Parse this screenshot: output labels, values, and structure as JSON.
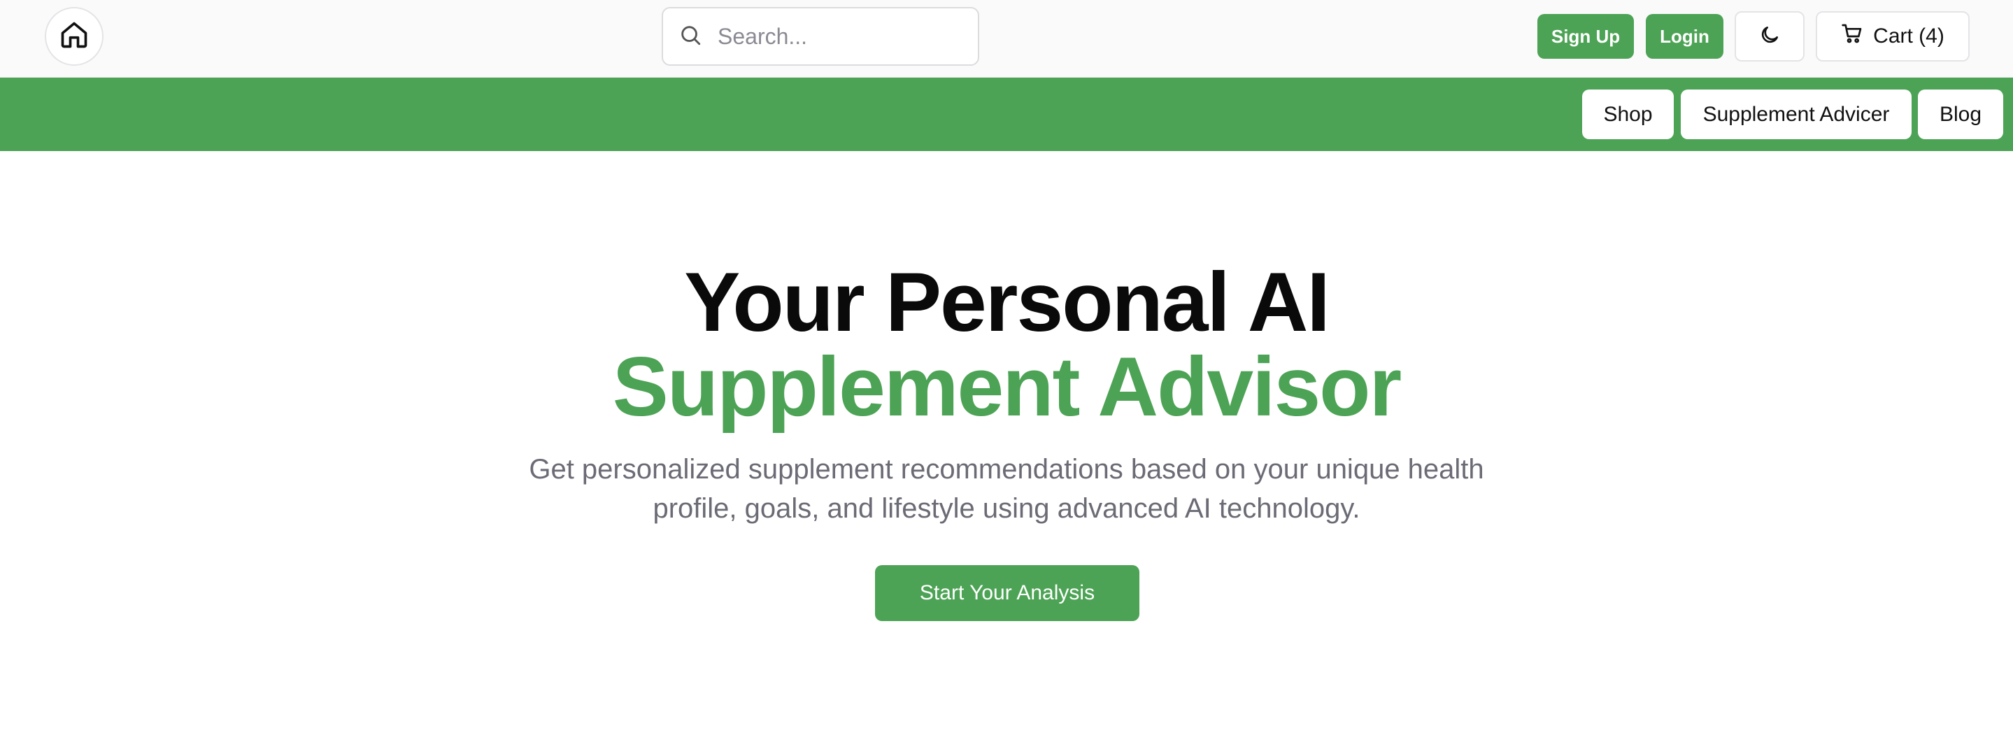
{
  "header": {
    "home_icon": "house-icon",
    "search": {
      "placeholder": "Search...",
      "value": "",
      "icon": "search-icon"
    },
    "signup_label": "Sign Up",
    "login_label": "Login",
    "theme_icon": "moon-icon",
    "cart": {
      "label": "Cart (4)",
      "icon": "cart-icon"
    }
  },
  "nav": {
    "items": [
      {
        "label": "Shop"
      },
      {
        "label": "Supplement Advicer"
      },
      {
        "label": "Blog"
      }
    ]
  },
  "hero": {
    "title_line1": "Your Personal AI",
    "title_line2": "Supplement Advisor",
    "subtitle": "Get personalized supplement recommendations based on your unique health profile, goals, and lifestyle using advanced AI technology.",
    "cta_label": "Start Your Analysis"
  },
  "colors": {
    "brand_green": "#4da355",
    "topbar_bg": "#fafafa",
    "text_dark": "#0a0a0a",
    "text_muted": "#6b6b75"
  }
}
